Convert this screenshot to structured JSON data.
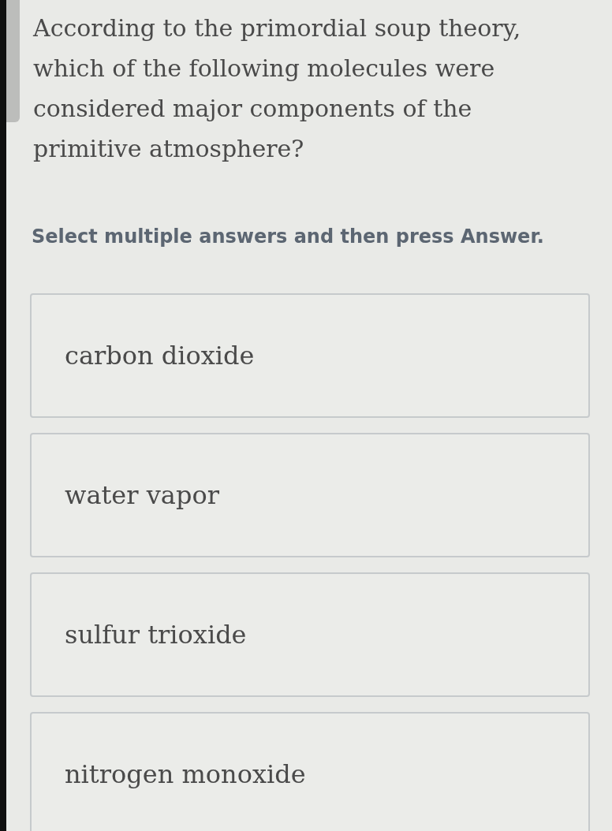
{
  "question": "According to the primordial soup theory, which of the following molecules were considered major components of the primitive atmosphere?",
  "instruction": "Select multiple answers and then press Answer.",
  "options": [
    {
      "label": "carbon dioxide",
      "selected": false
    },
    {
      "label": "water vapor",
      "selected": false
    },
    {
      "label": "sulfur trioxide",
      "selected": false
    },
    {
      "label": "nitrogen monoxide",
      "selected": false
    }
  ]
}
